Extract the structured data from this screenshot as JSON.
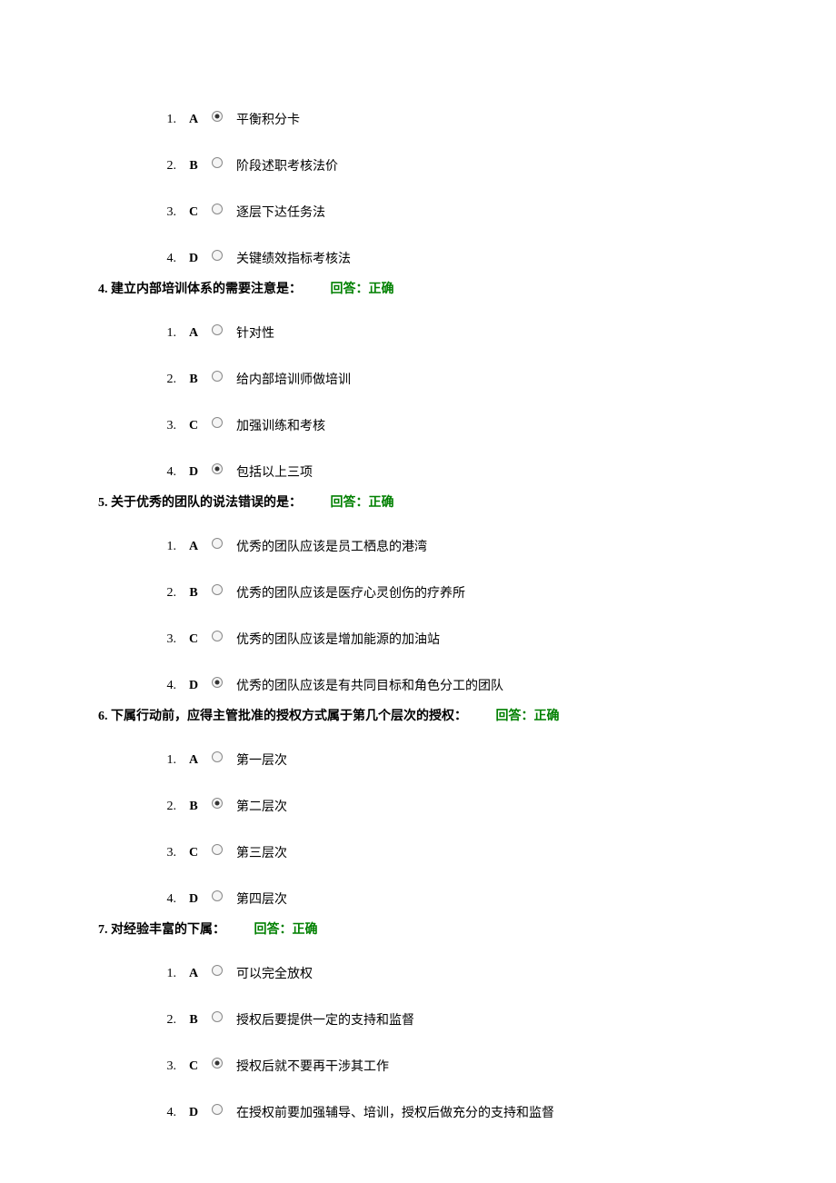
{
  "questions": [
    {
      "number": "",
      "text": "",
      "feedback": "",
      "options": [
        {
          "num": "1.",
          "letter": "A",
          "text": "平衡积分卡",
          "selected": true
        },
        {
          "num": "2.",
          "letter": "B",
          "text": "阶段述职考核法价",
          "selected": false
        },
        {
          "num": "3.",
          "letter": "C",
          "text": "逐层下达任务法",
          "selected": false
        },
        {
          "num": "4.",
          "letter": "D",
          "text": "关键绩效指标考核法",
          "selected": false
        }
      ]
    },
    {
      "number": "4.",
      "text": "建立内部培训体系的需要注意是：",
      "feedback": "回答：正确",
      "options": [
        {
          "num": "1.",
          "letter": "A",
          "text": "针对性",
          "selected": false
        },
        {
          "num": "2.",
          "letter": "B",
          "text": "给内部培训师做培训",
          "selected": false
        },
        {
          "num": "3.",
          "letter": "C",
          "text": "加强训练和考核",
          "selected": false
        },
        {
          "num": "4.",
          "letter": "D",
          "text": "包括以上三项",
          "selected": true
        }
      ]
    },
    {
      "number": "5.",
      "text": "关于优秀的团队的说法错误的是：",
      "feedback": "回答：正确",
      "options": [
        {
          "num": "1.",
          "letter": "A",
          "text": "优秀的团队应该是员工栖息的港湾",
          "selected": false
        },
        {
          "num": "2.",
          "letter": "B",
          "text": "优秀的团队应该是医疗心灵创伤的疗养所",
          "selected": false
        },
        {
          "num": "3.",
          "letter": "C",
          "text": "优秀的团队应该是增加能源的加油站",
          "selected": false
        },
        {
          "num": "4.",
          "letter": "D",
          "text": "优秀的团队应该是有共同目标和角色分工的团队",
          "selected": true
        }
      ]
    },
    {
      "number": "6.",
      "text": "下属行动前，应得主管批准的授权方式属于第几个层次的授权：",
      "feedback": "回答：正确",
      "options": [
        {
          "num": "1.",
          "letter": "A",
          "text": "第一层次",
          "selected": false
        },
        {
          "num": "2.",
          "letter": "B",
          "text": "第二层次",
          "selected": true
        },
        {
          "num": "3.",
          "letter": "C",
          "text": "第三层次",
          "selected": false
        },
        {
          "num": "4.",
          "letter": "D",
          "text": "第四层次",
          "selected": false
        }
      ]
    },
    {
      "number": "7.",
      "text": "对经验丰富的下属：",
      "feedback": "回答：正确",
      "options": [
        {
          "num": "1.",
          "letter": "A",
          "text": "可以完全放权",
          "selected": false
        },
        {
          "num": "2.",
          "letter": "B",
          "text": "授权后要提供一定的支持和监督",
          "selected": false
        },
        {
          "num": "3.",
          "letter": "C",
          "text": "授权后就不要再干涉其工作",
          "selected": true
        },
        {
          "num": "4.",
          "letter": "D",
          "text": "在授权前要加强辅导、培训，授权后做充分的支持和监督",
          "selected": false
        }
      ]
    }
  ]
}
